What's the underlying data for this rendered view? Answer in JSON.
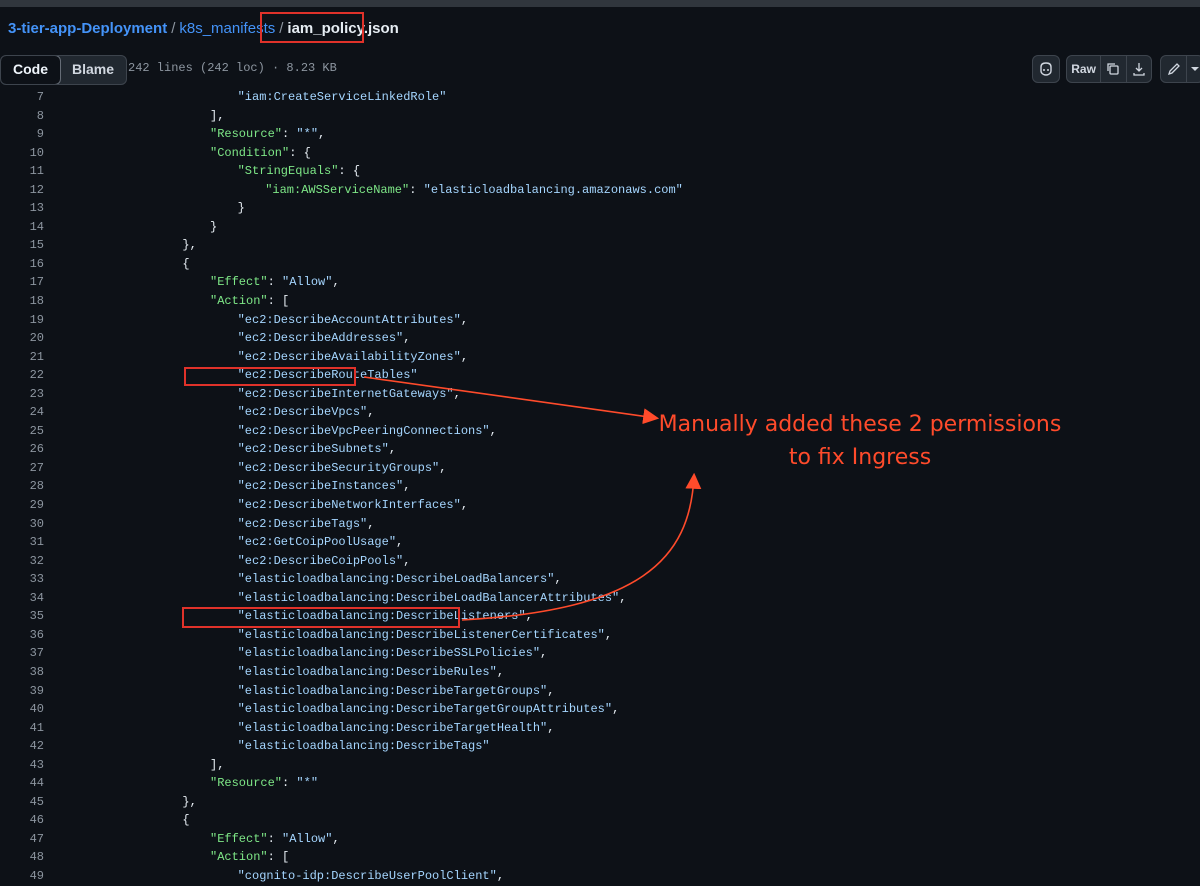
{
  "breadcrumb": {
    "repo": "3-tier-app-Deployment",
    "folder": "k8s_manifests",
    "separator": "/",
    "file": "iam_policy.json"
  },
  "toolbar": {
    "code_tab": "Code",
    "blame_tab": "Blame",
    "file_info": "242 lines (242 loc) · 8.23 KB",
    "raw_label": "Raw"
  },
  "annotation": {
    "line1": "Manually added these 2 permissions",
    "line2": "to fix Ingress"
  },
  "code_lines": [
    {
      "n": "7",
      "indent": 24,
      "parts": [
        [
          "str",
          "\"iam:CreateServiceLinkedRole\""
        ]
      ]
    },
    {
      "n": "8",
      "indent": 20,
      "parts": [
        [
          "p",
          "],"
        ]
      ]
    },
    {
      "n": "9",
      "indent": 20,
      "parts": [
        [
          "key",
          "\"Resource\""
        ],
        [
          "p",
          ": "
        ],
        [
          "str",
          "\"*\""
        ],
        [
          "p",
          ","
        ]
      ]
    },
    {
      "n": "10",
      "indent": 20,
      "parts": [
        [
          "key",
          "\"Condition\""
        ],
        [
          "p",
          ": {"
        ]
      ]
    },
    {
      "n": "11",
      "indent": 24,
      "parts": [
        [
          "key",
          "\"StringEquals\""
        ],
        [
          "p",
          ": {"
        ]
      ]
    },
    {
      "n": "12",
      "indent": 28,
      "parts": [
        [
          "key",
          "\"iam:AWSServiceName\""
        ],
        [
          "p",
          ": "
        ],
        [
          "str",
          "\"elasticloadbalancing.amazonaws.com\""
        ]
      ]
    },
    {
      "n": "13",
      "indent": 24,
      "parts": [
        [
          "p",
          "}"
        ]
      ]
    },
    {
      "n": "14",
      "indent": 20,
      "parts": [
        [
          "p",
          "}"
        ]
      ]
    },
    {
      "n": "15",
      "indent": 16,
      "parts": [
        [
          "p",
          "},"
        ]
      ]
    },
    {
      "n": "16",
      "indent": 16,
      "parts": [
        [
          "p",
          "{"
        ]
      ]
    },
    {
      "n": "17",
      "indent": 20,
      "parts": [
        [
          "key",
          "\"Effect\""
        ],
        [
          "p",
          ": "
        ],
        [
          "str",
          "\"Allow\""
        ],
        [
          "p",
          ","
        ]
      ]
    },
    {
      "n": "18",
      "indent": 20,
      "parts": [
        [
          "key",
          "\"Action\""
        ],
        [
          "p",
          ": ["
        ]
      ]
    },
    {
      "n": "19",
      "indent": 24,
      "parts": [
        [
          "str",
          "\"ec2:DescribeAccountAttributes\""
        ],
        [
          "p",
          ","
        ]
      ]
    },
    {
      "n": "20",
      "indent": 24,
      "parts": [
        [
          "str",
          "\"ec2:DescribeAddresses\""
        ],
        [
          "p",
          ","
        ]
      ]
    },
    {
      "n": "21",
      "indent": 24,
      "parts": [
        [
          "str",
          "\"ec2:DescribeAvailabilityZones\""
        ],
        [
          "p",
          ","
        ]
      ]
    },
    {
      "n": "22",
      "indent": 24,
      "parts": [
        [
          "str",
          "\"ec2:DescribeRouteTables\""
        ]
      ]
    },
    {
      "n": "23",
      "indent": 24,
      "parts": [
        [
          "str",
          "\"ec2:DescribeInternetGateways\""
        ],
        [
          "p",
          ","
        ]
      ]
    },
    {
      "n": "24",
      "indent": 24,
      "parts": [
        [
          "str",
          "\"ec2:DescribeVpcs\""
        ],
        [
          "p",
          ","
        ]
      ]
    },
    {
      "n": "25",
      "indent": 24,
      "parts": [
        [
          "str",
          "\"ec2:DescribeVpcPeeringConnections\""
        ],
        [
          "p",
          ","
        ]
      ]
    },
    {
      "n": "26",
      "indent": 24,
      "parts": [
        [
          "str",
          "\"ec2:DescribeSubnets\""
        ],
        [
          "p",
          ","
        ]
      ]
    },
    {
      "n": "27",
      "indent": 24,
      "parts": [
        [
          "str",
          "\"ec2:DescribeSecurityGroups\""
        ],
        [
          "p",
          ","
        ]
      ]
    },
    {
      "n": "28",
      "indent": 24,
      "parts": [
        [
          "str",
          "\"ec2:DescribeInstances\""
        ],
        [
          "p",
          ","
        ]
      ]
    },
    {
      "n": "29",
      "indent": 24,
      "parts": [
        [
          "str",
          "\"ec2:DescribeNetworkInterfaces\""
        ],
        [
          "p",
          ","
        ]
      ]
    },
    {
      "n": "30",
      "indent": 24,
      "parts": [
        [
          "str",
          "\"ec2:DescribeTags\""
        ],
        [
          "p",
          ","
        ]
      ]
    },
    {
      "n": "31",
      "indent": 24,
      "parts": [
        [
          "str",
          "\"ec2:GetCoipPoolUsage\""
        ],
        [
          "p",
          ","
        ]
      ]
    },
    {
      "n": "32",
      "indent": 24,
      "parts": [
        [
          "str",
          "\"ec2:DescribeCoipPools\""
        ],
        [
          "p",
          ","
        ]
      ]
    },
    {
      "n": "33",
      "indent": 24,
      "parts": [
        [
          "str",
          "\"elasticloadbalancing:DescribeLoadBalancers\""
        ],
        [
          "p",
          ","
        ]
      ]
    },
    {
      "n": "34",
      "indent": 24,
      "parts": [
        [
          "str",
          "\"elasticloadbalancing:DescribeLoadBalancerAttributes\""
        ],
        [
          "p",
          ","
        ]
      ]
    },
    {
      "n": "35",
      "indent": 24,
      "parts": [
        [
          "str",
          "\"elasticloadbalancing:DescribeListeners\""
        ],
        [
          "p",
          ","
        ]
      ]
    },
    {
      "n": "36",
      "indent": 24,
      "parts": [
        [
          "str",
          "\"elasticloadbalancing:DescribeListenerCertificates\""
        ],
        [
          "p",
          ","
        ]
      ]
    },
    {
      "n": "37",
      "indent": 24,
      "parts": [
        [
          "str",
          "\"elasticloadbalancing:DescribeSSLPolicies\""
        ],
        [
          "p",
          ","
        ]
      ]
    },
    {
      "n": "38",
      "indent": 24,
      "parts": [
        [
          "str",
          "\"elasticloadbalancing:DescribeRules\""
        ],
        [
          "p",
          ","
        ]
      ]
    },
    {
      "n": "39",
      "indent": 24,
      "parts": [
        [
          "str",
          "\"elasticloadbalancing:DescribeTargetGroups\""
        ],
        [
          "p",
          ","
        ]
      ]
    },
    {
      "n": "40",
      "indent": 24,
      "parts": [
        [
          "str",
          "\"elasticloadbalancing:DescribeTargetGroupAttributes\""
        ],
        [
          "p",
          ","
        ]
      ]
    },
    {
      "n": "41",
      "indent": 24,
      "parts": [
        [
          "str",
          "\"elasticloadbalancing:DescribeTargetHealth\""
        ],
        [
          "p",
          ","
        ]
      ]
    },
    {
      "n": "42",
      "indent": 24,
      "parts": [
        [
          "str",
          "\"elasticloadbalancing:DescribeTags\""
        ]
      ]
    },
    {
      "n": "43",
      "indent": 20,
      "parts": [
        [
          "p",
          "],"
        ]
      ]
    },
    {
      "n": "44",
      "indent": 20,
      "parts": [
        [
          "key",
          "\"Resource\""
        ],
        [
          "p",
          ": "
        ],
        [
          "str",
          "\"*\""
        ]
      ]
    },
    {
      "n": "45",
      "indent": 16,
      "parts": [
        [
          "p",
          "},"
        ]
      ]
    },
    {
      "n": "46",
      "indent": 16,
      "parts": [
        [
          "p",
          "{"
        ]
      ]
    },
    {
      "n": "47",
      "indent": 20,
      "parts": [
        [
          "key",
          "\"Effect\""
        ],
        [
          "p",
          ": "
        ],
        [
          "str",
          "\"Allow\""
        ],
        [
          "p",
          ","
        ]
      ]
    },
    {
      "n": "48",
      "indent": 20,
      "parts": [
        [
          "key",
          "\"Action\""
        ],
        [
          "p",
          ": ["
        ]
      ]
    },
    {
      "n": "49",
      "indent": 24,
      "parts": [
        [
          "str",
          "\"cognito-idp:DescribeUserPoolClient\""
        ],
        [
          "p",
          ","
        ]
      ]
    }
  ]
}
